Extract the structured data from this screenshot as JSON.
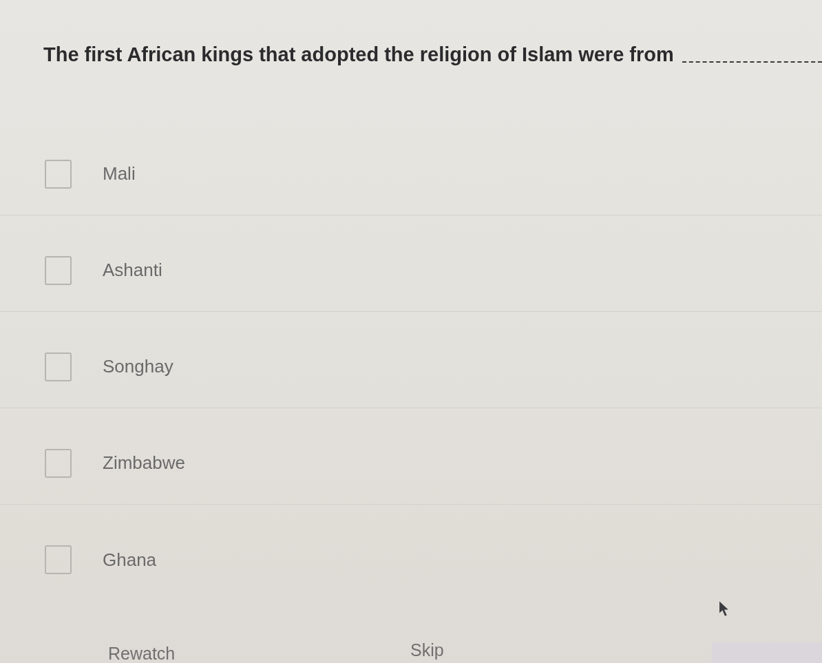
{
  "question": {
    "text": "The first African kings that adopted the religion of Islam were from",
    "blank": true
  },
  "options": [
    {
      "label": "Mali",
      "checked": false
    },
    {
      "label": "Ashanti",
      "checked": false
    },
    {
      "label": "Songhay",
      "checked": false
    },
    {
      "label": "Zimbabwe",
      "checked": false
    },
    {
      "label": "Ghana",
      "checked": false
    }
  ],
  "footer": {
    "buttons": [
      {
        "label": "Rewatch"
      },
      {
        "label": "Skip"
      }
    ],
    "next_button": {
      "disabled": true
    }
  }
}
